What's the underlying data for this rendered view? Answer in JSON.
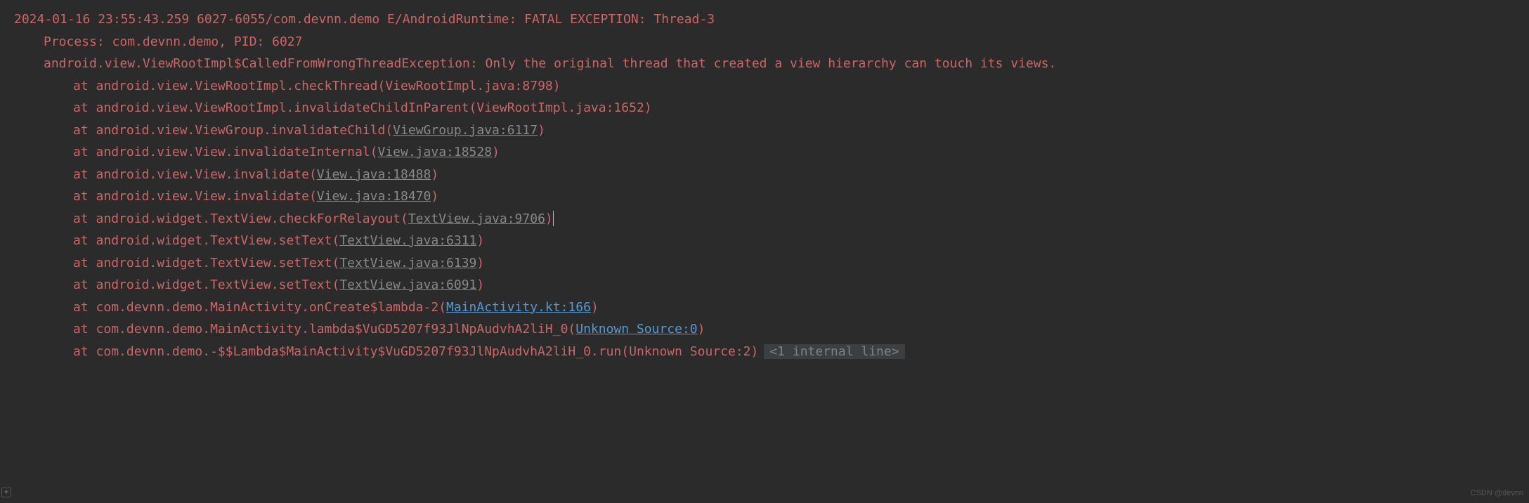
{
  "header": {
    "timestamp": "2024-01-16 23:55:43.259",
    "pids": "6027-6055",
    "package": "com.devnn.demo",
    "tag": "E/AndroidRuntime:",
    "message": "FATAL EXCEPTION: Thread-3"
  },
  "process": "Process: com.devnn.demo, PID: 6027",
  "exception": "android.view.ViewRootImpl$CalledFromWrongThreadException: Only the original thread that created a view hierarchy can touch its views.",
  "stack": [
    {
      "at": "at",
      "method": "android.view.ViewRootImpl.checkThread",
      "file": "ViewRootImpl.java:8798",
      "linkType": "none"
    },
    {
      "at": "at",
      "method": "android.view.ViewRootImpl.invalidateChildInParent",
      "file": "ViewRootImpl.java:1652",
      "linkType": "none"
    },
    {
      "at": "at",
      "method": "android.view.ViewGroup.invalidateChild",
      "file": "ViewGroup.java:6117",
      "linkType": "gray"
    },
    {
      "at": "at",
      "method": "android.view.View.invalidateInternal",
      "file": "View.java:18528",
      "linkType": "gray"
    },
    {
      "at": "at",
      "method": "android.view.View.invalidate",
      "file": "View.java:18488",
      "linkType": "gray"
    },
    {
      "at": "at",
      "method": "android.view.View.invalidate",
      "file": "View.java:18470",
      "linkType": "gray"
    },
    {
      "at": "at",
      "method": "android.widget.TextView.checkForRelayout",
      "file": "TextView.java:9706",
      "linkType": "gray",
      "cursor": true
    },
    {
      "at": "at",
      "method": "android.widget.TextView.setText",
      "file": "TextView.java:6311",
      "linkType": "gray"
    },
    {
      "at": "at",
      "method": "android.widget.TextView.setText",
      "file": "TextView.java:6139",
      "linkType": "gray"
    },
    {
      "at": "at",
      "method": "android.widget.TextView.setText",
      "file": "TextView.java:6091",
      "linkType": "gray"
    },
    {
      "at": "at",
      "method": "com.devnn.demo.MainActivity.onCreate$lambda-2",
      "file": "MainActivity.kt:166",
      "linkType": "blue"
    },
    {
      "at": "at",
      "method": "com.devnn.demo.MainActivity.lambda$VuGD5207f93JlNpAudvhA2liH_0",
      "file": "Unknown Source:0",
      "linkType": "blue"
    },
    {
      "at": "at",
      "method": "com.devnn.demo.-$$Lambda$MainActivity$VuGD5207f93JlNpAudvhA2liH_0.run",
      "file": "Unknown Source:2",
      "linkType": "none",
      "internal": "<1 internal line>"
    }
  ],
  "expand_icon": "+",
  "watermark": "CSDN @devnn"
}
